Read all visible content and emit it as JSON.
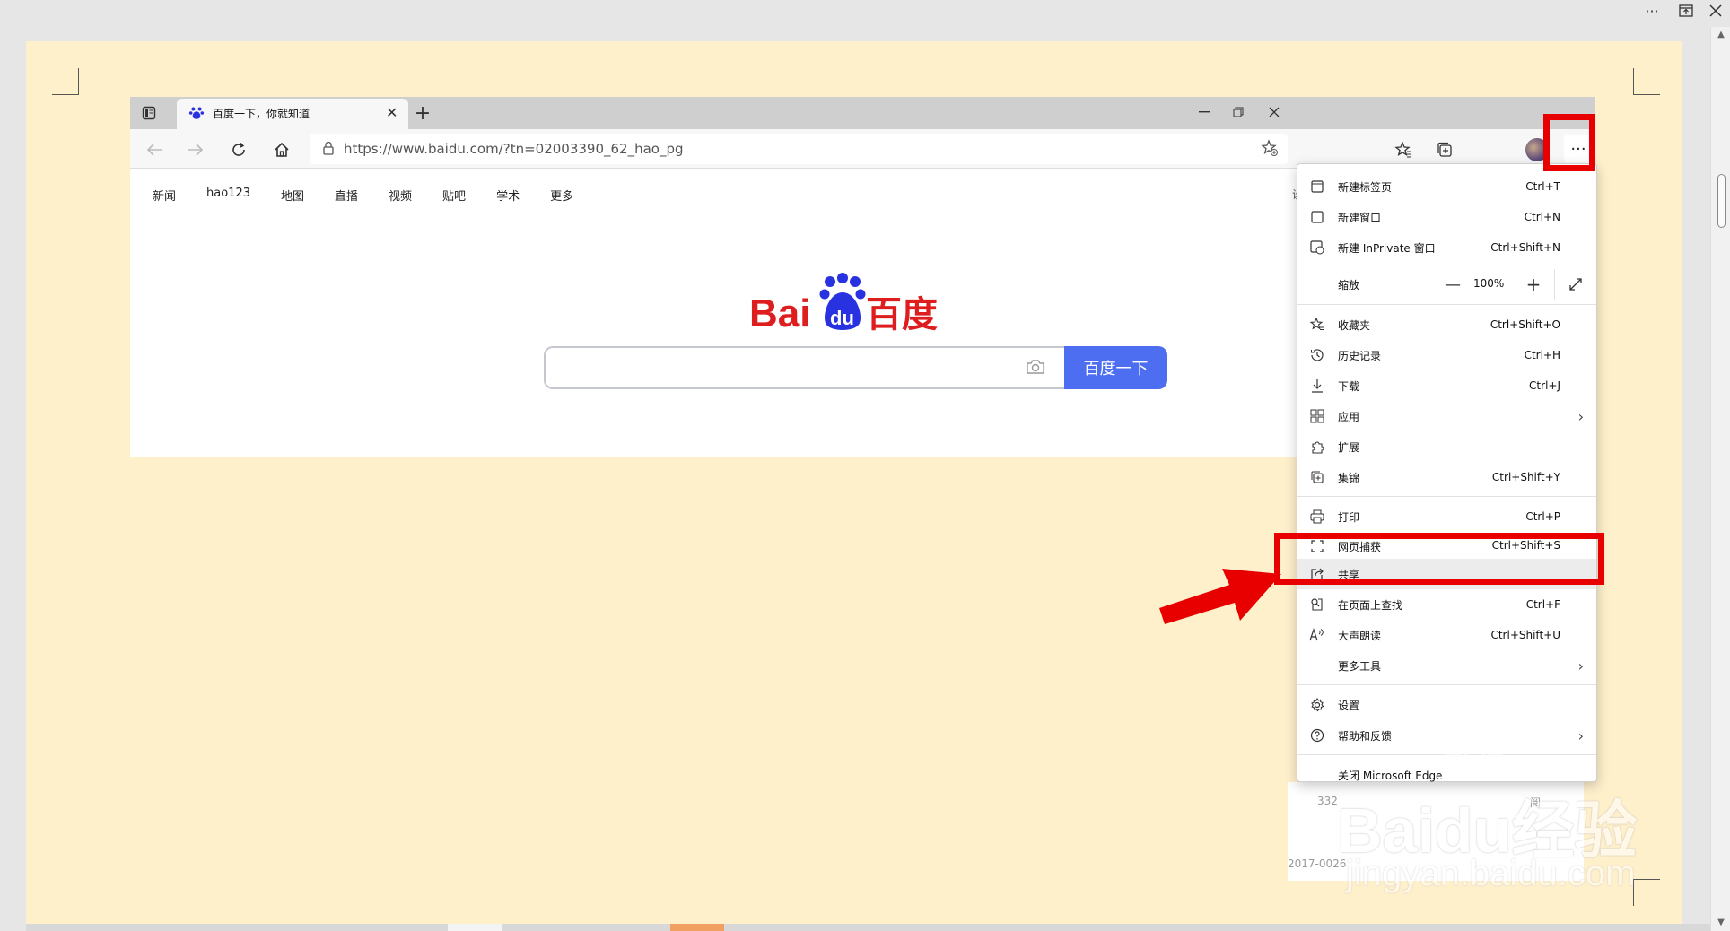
{
  "viewer": {
    "more_label": "···"
  },
  "tab": {
    "title": "百度一下，你就知道",
    "close": "✕",
    "new": "+"
  },
  "address": {
    "url": "https://www.baidu.com/?tn=02003390_62_hao_pg"
  },
  "nav_links": [
    "新闻",
    "hao123",
    "地图",
    "直播",
    "视频",
    "贴吧",
    "学术",
    "更多"
  ],
  "search": {
    "button_label": "百度一下"
  },
  "logo": {
    "text_left": "Bai",
    "text_du": "du",
    "text_right": "百度"
  },
  "menu": {
    "new_tab": {
      "label": "新建标签页",
      "shortcut": "Ctrl+T"
    },
    "new_window": {
      "label": "新建窗口",
      "shortcut": "Ctrl+N"
    },
    "new_inprivate": {
      "label": "新建 InPrivate 窗口",
      "shortcut": "Ctrl+Shift+N"
    },
    "zoom": {
      "label": "缩放",
      "value": "100%"
    },
    "favorites": {
      "label": "收藏夹",
      "shortcut": "Ctrl+Shift+O"
    },
    "history": {
      "label": "历史记录",
      "shortcut": "Ctrl+H"
    },
    "downloads": {
      "label": "下载",
      "shortcut": "Ctrl+J"
    },
    "apps": {
      "label": "应用"
    },
    "extensions": {
      "label": "扩展"
    },
    "collections": {
      "label": "集锦",
      "shortcut": "Ctrl+Shift+Y"
    },
    "print": {
      "label": "打印",
      "shortcut": "Ctrl+P"
    },
    "web_capture": {
      "label": "网页捕获",
      "shortcut": "Ctrl+Shift+S"
    },
    "share": {
      "label": "共享"
    },
    "find": {
      "label": "在页面上查找",
      "shortcut": "Ctrl+F"
    },
    "read_aloud": {
      "label": "大声朗读",
      "shortcut": "Ctrl+Shift+U"
    },
    "more_tools": {
      "label": "更多工具"
    },
    "settings": {
      "label": "设置"
    },
    "help": {
      "label": "帮助和反馈"
    },
    "close_edge": {
      "label": "关闭 Microsoft Edge"
    }
  },
  "behind": {
    "text1": "332",
    "text2": "2017-0026",
    "text3": "阅"
  },
  "watermark": {
    "line1": "Baidu经验",
    "line2": "jingyan.baidu.com"
  },
  "colors": {
    "page_bg": "#fff0cc",
    "highlight_red": "#e80000",
    "baidu_blue": "#4e6ef2",
    "baidu_red": "#de1e1e"
  }
}
